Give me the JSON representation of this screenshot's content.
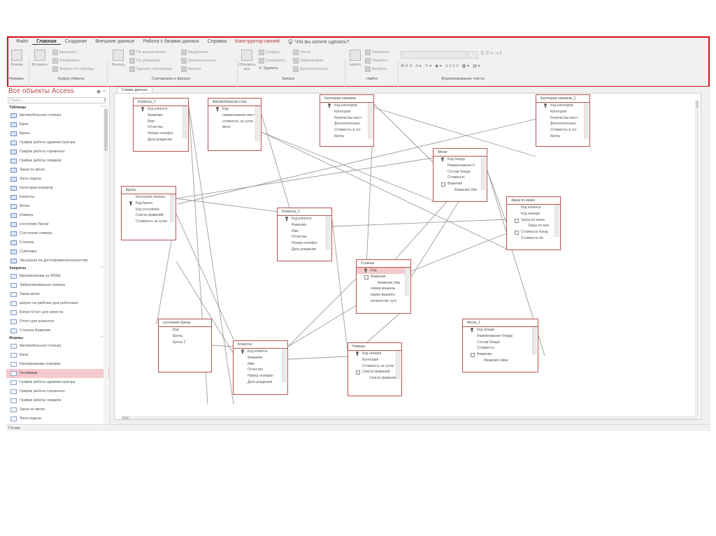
{
  "ribbon": {
    "tabs": [
      {
        "label": "Файл"
      },
      {
        "label": "Главная"
      },
      {
        "label": "Создание"
      },
      {
        "label": "Внешние данные"
      },
      {
        "label": "Работа с базами данных"
      },
      {
        "label": "Справка"
      },
      {
        "label": "Конструктор связей"
      }
    ],
    "tell_me": "Что вы хотите сделать?",
    "views": "Режимы",
    "view_btn": "Режим",
    "paste_btn": "Вставить",
    "cut": "Вырезать",
    "copy": "Копировать",
    "format_painter": "Формат по образцу",
    "filter_btn": "Фильтр",
    "sort_asc": "По возрастанию",
    "sort_desc": "По убыванию",
    "remove_sort": "Удалить сортировку",
    "selection": "Выделение",
    "advanced": "Дополнительно",
    "toggle_filter": "Фильтр",
    "refresh_btn": "Обновить все",
    "new_rec": "Создать",
    "save_rec": "Сохранить",
    "delete_rec": "Удалить",
    "totals": "Итоги",
    "spelling": "Орфография",
    "more": "Дополнительно",
    "find_btn": "Найти",
    "replace": "Заменить",
    "goto": "Перейти",
    "select": "Выбрать",
    "groups": {
      "clipboard": "Буфер обмена",
      "sort_filter": "Сортировка и фильтр",
      "records": "Записи",
      "find": "Найти",
      "text_format": "Форматирование текста"
    }
  },
  "nav": {
    "title": "Все объекты Access",
    "search_placeholder": "Поиск...",
    "sections": [
      {
        "name": "Таблицы",
        "kind": "table",
        "items": [
          "Автомобильная стоянка",
          "Бани",
          "Бронь",
          "График работы администратора",
          "График работы горничных",
          "График работы поваров",
          "Заказ по меню",
          "Зона отдыха",
          "Категории номеров",
          "Клиенты",
          "Меню",
          "Номера",
          "состояние брони",
          "Состояние номера",
          "Стоянка",
          "Сувениры",
          "Экскурсии по достопримечательностям"
        ]
      },
      {
        "name": "Запросы",
        "kind": "query",
        "items": [
          "Бронирование за 4000р",
          "Забронированные номера",
          "Заказ меню",
          "запрос на рабочие дни работника",
          "Копия Отчет для клиента",
          "Отчет для клиентов",
          "Стоянка Фамилии"
        ]
      },
      {
        "name": "Формы",
        "kind": "form",
        "items": [
          "Автомобильная стоянка",
          "Бани",
          "Бронирование номеров",
          "Гостиница",
          "График работы администратора",
          "График работы горничных",
          "График работы поваров",
          "Заказ по меню",
          "Зона отдыха"
        ],
        "selected": 3
      }
    ]
  },
  "doc_tab": "Схема данных",
  "status": "Готово",
  "tables": [
    {
      "name": "Клиенты_1",
      "fields": [
        {
          "t": "Код клиента",
          "key": true
        },
        {
          "t": "Фамилия"
        },
        {
          "t": "Имя"
        },
        {
          "t": "Отчество"
        },
        {
          "t": "Номер телефон"
        },
        {
          "t": "Дата рождения"
        }
      ]
    },
    {
      "name": "Автомобильная стоя...",
      "fields": [
        {
          "t": "Код",
          "key": true
        },
        {
          "t": "наименование мест"
        },
        {
          "t": "стоимость за сутки"
        },
        {
          "t": "фото"
        }
      ]
    },
    {
      "name": "Категории номеров",
      "fields": [
        {
          "t": "Код категории",
          "key": true
        },
        {
          "t": "Категория"
        },
        {
          "t": "Количество мест"
        },
        {
          "t": "Дополнительны"
        },
        {
          "t": "Стоимость в сут"
        },
        {
          "t": "Бронь"
        }
      ]
    },
    {
      "name": "Категории номеров_1",
      "fields": [
        {
          "t": "Код категории",
          "key": true
        },
        {
          "t": "Категория"
        },
        {
          "t": "Количество мест"
        },
        {
          "t": "Дополнительны"
        },
        {
          "t": "Стоимость в сут"
        },
        {
          "t": "Бронь"
        }
      ]
    },
    {
      "name": "Меню",
      "fields": [
        {
          "t": "Код блюда",
          "key": true
        },
        {
          "t": "Наименование б"
        },
        {
          "t": "Состав блюда"
        },
        {
          "t": "Стоимость"
        },
        {
          "t": "Фамилия",
          "cb": true
        },
        {
          "t": "Фамилия.Valu",
          "sub": true
        }
      ]
    },
    {
      "name": "Бронь",
      "fields": [
        {
          "t": "Категория номера"
        },
        {
          "t": "Код брони",
          "key": true
        },
        {
          "t": "Код состояния"
        },
        {
          "t": "Список фамилий"
        },
        {
          "t": "Стоимость за сутки"
        }
      ]
    },
    {
      "name": "Клиенты_2",
      "fields": [
        {
          "t": "Код клиента",
          "key": true
        },
        {
          "t": "Фамилия"
        },
        {
          "t": "Имя"
        },
        {
          "t": "Отчество"
        },
        {
          "t": "Номер телефон"
        },
        {
          "t": "Дата рождения"
        }
      ]
    },
    {
      "name": "Заказ по меню",
      "fields": [
        {
          "t": "Код клиента"
        },
        {
          "t": "Код номера"
        },
        {
          "t": "Заказ по меню",
          "cb": true
        },
        {
          "t": "Заказ по мен",
          "sub": true
        },
        {
          "t": "Стоимость блюд",
          "cb": true
        },
        {
          "t": "Стоимость Ас"
        }
      ]
    },
    {
      "name": "Стоянка",
      "fields": [
        {
          "t": "Код",
          "key": true,
          "hl": true
        },
        {
          "t": "Фамилия",
          "cb": true
        },
        {
          "t": "Фамилия.Valu",
          "sub": true
        },
        {
          "t": "номер машины"
        },
        {
          "t": "марка машины"
        },
        {
          "t": "количество сутк"
        }
      ]
    },
    {
      "name": "состояние брони",
      "fields": [
        {
          "t": "Код"
        },
        {
          "t": "Бронь"
        },
        {
          "t": "Бронь 2"
        }
      ]
    },
    {
      "name": "Меню_1",
      "fields": [
        {
          "t": "Код блюда",
          "key": true
        },
        {
          "t": "Наименование блюда"
        },
        {
          "t": "Состав блюда"
        },
        {
          "t": "Стоимость"
        },
        {
          "t": "Фамилия",
          "cb": true
        },
        {
          "t": "Фамилия.Value",
          "sub": true
        }
      ]
    },
    {
      "name": "Клиенты",
      "fields": [
        {
          "t": "Код клиента",
          "key": true
        },
        {
          "t": "Фамилия"
        },
        {
          "t": "Имя"
        },
        {
          "t": "Отчество"
        },
        {
          "t": "Номер телефон"
        },
        {
          "t": "Дата рождения"
        }
      ]
    },
    {
      "name": "Номера",
      "fields": [
        {
          "t": "Код номера",
          "key": true
        },
        {
          "t": "Категория"
        },
        {
          "t": "Стоимость за сутки"
        },
        {
          "t": "Список фамилий",
          "cb": true
        },
        {
          "t": "Список фамилий",
          "sub": true
        }
      ]
    }
  ]
}
